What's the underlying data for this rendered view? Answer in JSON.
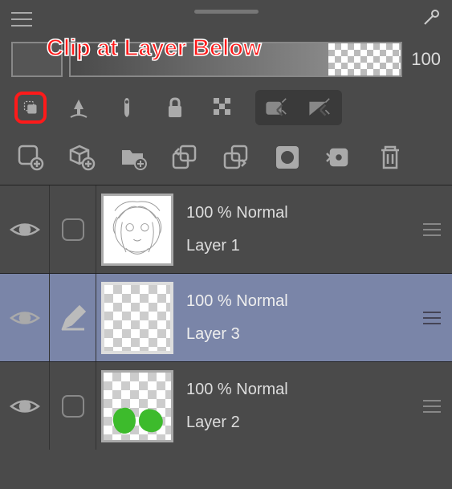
{
  "annotation": "Clip at Layer Below",
  "opacity_value": "100",
  "layers": [
    {
      "blend": "100 % Normal",
      "name": "Layer 1"
    },
    {
      "blend": "100 % Normal",
      "name": "Layer 3"
    },
    {
      "blend": "100 % Normal",
      "name": "Layer 2"
    }
  ]
}
